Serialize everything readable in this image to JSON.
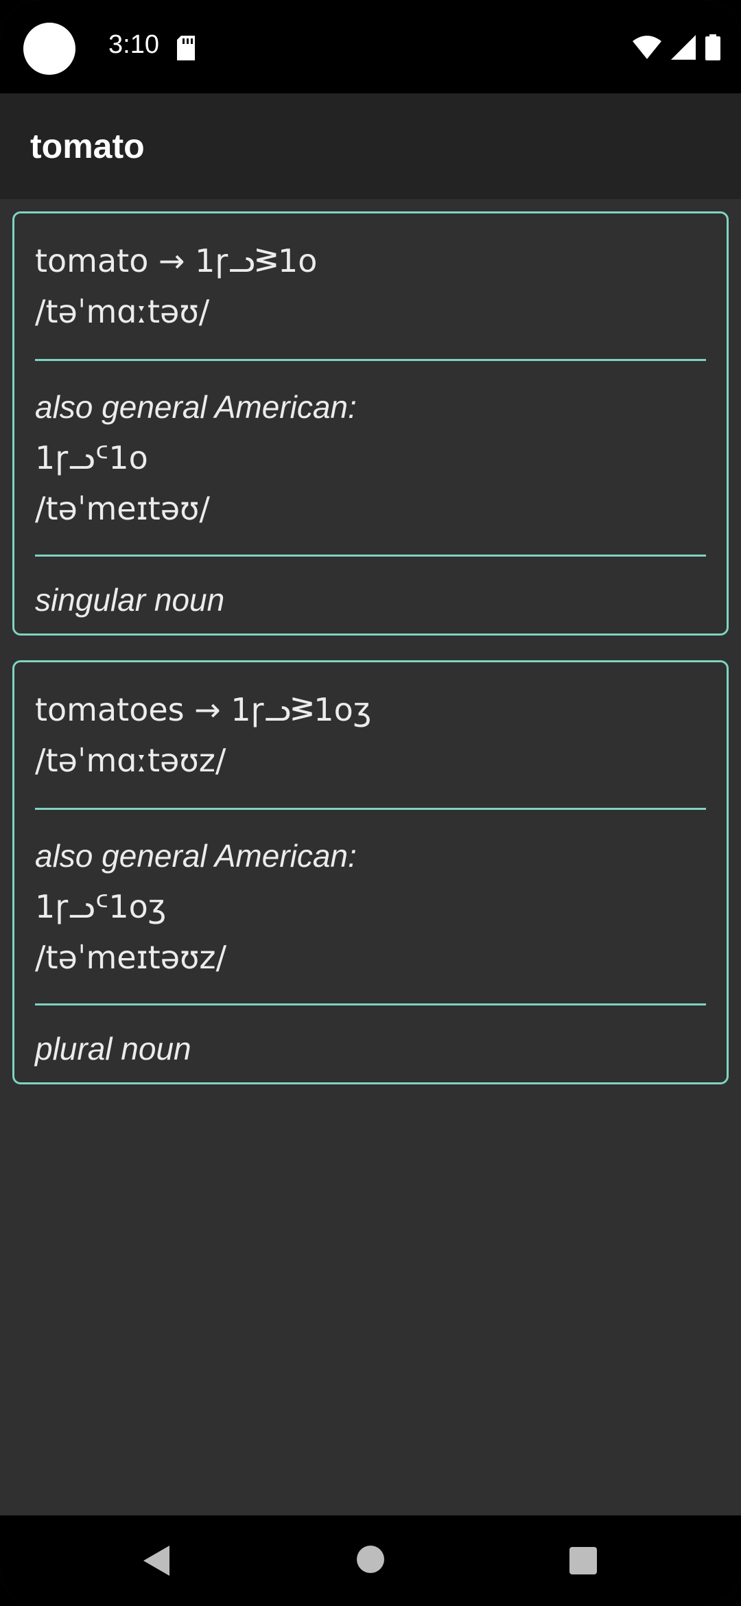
{
  "status": {
    "time": "3:10"
  },
  "appbar": {
    "title": "tomato"
  },
  "entries": [
    {
      "headword": "tomato → 1ɼᓗᕒ1o",
      "ipa": "/təˈmɑːtəʊ/",
      "variant_label": "also general American:",
      "variant_spelling": "1ɼᓗᑦ1o",
      "variant_ipa": "/təˈmeɪtəʊ/",
      "pos": "singular noun"
    },
    {
      "headword": "tomatoes → 1ɼᓗᕒ1oʒ",
      "ipa": "/təˈmɑːtəʊz/",
      "variant_label": "also general American:",
      "variant_spelling": "1ɼᓗᑦ1oʒ",
      "variant_ipa": "/təˈmeɪtəʊz/",
      "pos": "plural noun"
    }
  ],
  "colors": {
    "accent": "#7fd4c1",
    "background": "#303030",
    "appbar": "#232323"
  },
  "icons": {
    "wifi": "wifi-icon",
    "signal": "signal-icon",
    "battery": "battery-icon",
    "sd": "sd-card-icon"
  }
}
